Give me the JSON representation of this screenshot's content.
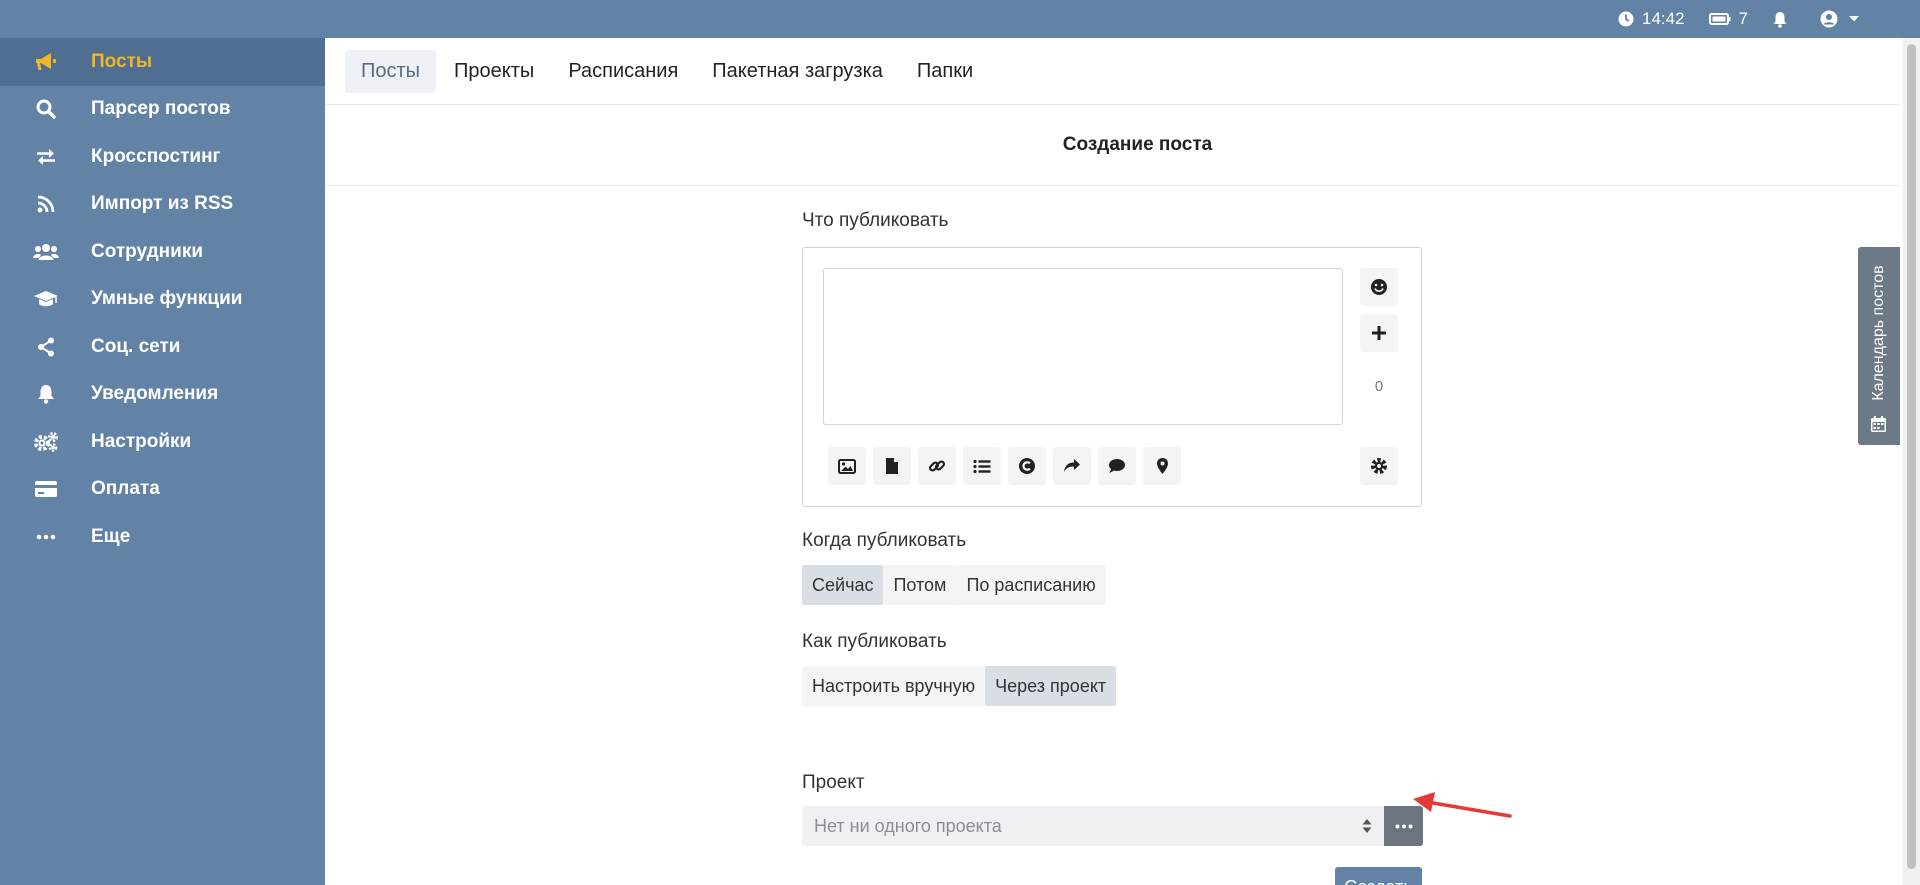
{
  "topbar": {
    "time": "14:42",
    "count": "7"
  },
  "sidebar": {
    "items": [
      {
        "label": "Посты",
        "icon": "megaphone-icon",
        "active": true
      },
      {
        "label": "Парсер постов",
        "icon": "search-icon"
      },
      {
        "label": "Кросспостинг",
        "icon": "exchange-icon"
      },
      {
        "label": "Импорт из RSS",
        "icon": "rss-icon"
      },
      {
        "label": "Сотрудники",
        "icon": "users-icon"
      },
      {
        "label": "Умные функции",
        "icon": "graduation-cap-icon"
      },
      {
        "label": "Соц. сети",
        "icon": "share-icon"
      },
      {
        "label": "Уведомления",
        "icon": "bell-icon"
      },
      {
        "label": "Настройки",
        "icon": "cogs-icon"
      },
      {
        "label": "Оплата",
        "icon": "credit-card-icon"
      },
      {
        "label": "Еще",
        "icon": "ellipsis-icon"
      }
    ]
  },
  "tabs": [
    "Посты",
    "Проекты",
    "Расписания",
    "Пакетная загрузка",
    "Папки"
  ],
  "page": {
    "title": "Создание поста"
  },
  "form": {
    "what_label": "Что публиковать",
    "char_count": "0",
    "when_label": "Когда публиковать",
    "when_options": [
      "Сейчас",
      "Потом",
      "По расписанию"
    ],
    "how_label": "Как публиковать",
    "how_options": [
      "Настроить вручную",
      "Через проект"
    ],
    "project_label": "Проект",
    "project_placeholder": "Нет ни одного проекта",
    "create_label": "Создать"
  },
  "calendar_tab": {
    "label": "Календарь постов"
  },
  "colors": {
    "brand": "#6283a6",
    "active_nav": "#f2b824",
    "arrow": "#e53935"
  }
}
